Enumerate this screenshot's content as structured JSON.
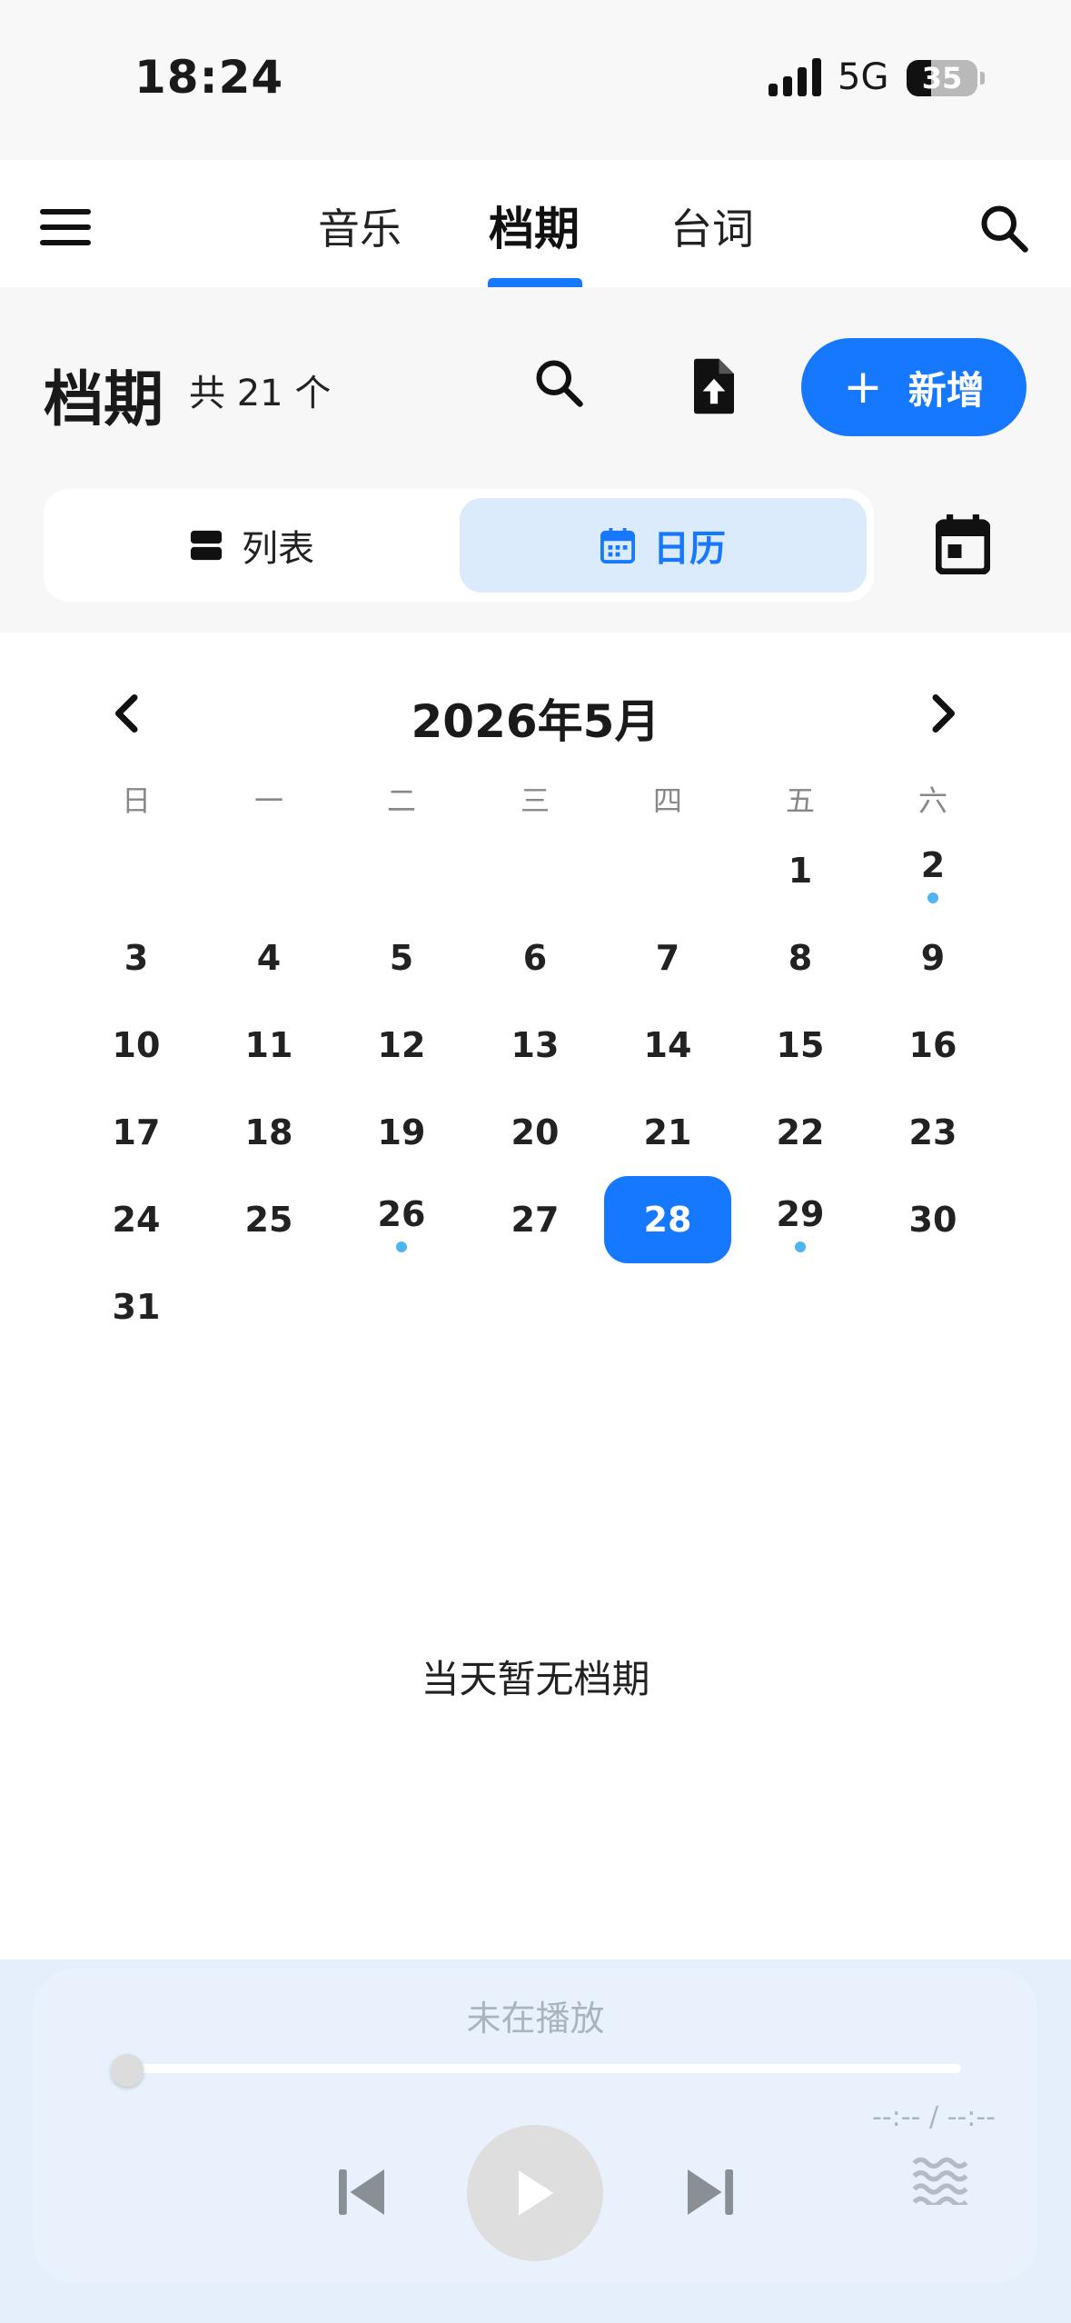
{
  "status_bar": {
    "time": "18:24",
    "network": "5G",
    "battery_text": "35",
    "battery_level": 0.35
  },
  "nav": {
    "tabs": [
      {
        "label": "音乐",
        "active": false
      },
      {
        "label": "档期",
        "active": true
      },
      {
        "label": "台词",
        "active": false
      }
    ]
  },
  "header": {
    "title": "档期",
    "count_text": "共 21 个",
    "add_label": "新增"
  },
  "view_toggle": {
    "list_label": "列表",
    "calendar_label": "日历",
    "selected": "calendar"
  },
  "calendar": {
    "month_title": "2026年5月",
    "weekdays": [
      "日",
      "一",
      "二",
      "三",
      "四",
      "五",
      "六"
    ],
    "days": [
      {
        "n": "1",
        "dot": false
      },
      {
        "n": "2",
        "dot": true
      },
      {
        "n": "3",
        "dot": false
      },
      {
        "n": "4",
        "dot": false
      },
      {
        "n": "5",
        "dot": false
      },
      {
        "n": "6",
        "dot": false
      },
      {
        "n": "7",
        "dot": false
      },
      {
        "n": "8",
        "dot": false
      },
      {
        "n": "9",
        "dot": false
      },
      {
        "n": "10",
        "dot": false
      },
      {
        "n": "11",
        "dot": false
      },
      {
        "n": "12",
        "dot": false
      },
      {
        "n": "13",
        "dot": false
      },
      {
        "n": "14",
        "dot": false
      },
      {
        "n": "15",
        "dot": false
      },
      {
        "n": "16",
        "dot": false
      },
      {
        "n": "17",
        "dot": false
      },
      {
        "n": "18",
        "dot": false
      },
      {
        "n": "19",
        "dot": false
      },
      {
        "n": "20",
        "dot": false
      },
      {
        "n": "21",
        "dot": false
      },
      {
        "n": "22",
        "dot": false
      },
      {
        "n": "23",
        "dot": false
      },
      {
        "n": "24",
        "dot": false
      },
      {
        "n": "25",
        "dot": false
      },
      {
        "n": "26",
        "dot": true
      },
      {
        "n": "27",
        "dot": false
      },
      {
        "n": "28",
        "dot": false
      },
      {
        "n": "29",
        "dot": true
      },
      {
        "n": "30",
        "dot": false
      },
      {
        "n": "31",
        "dot": false
      }
    ],
    "selected_day": "28",
    "empty_message": "当天暂无档期"
  },
  "player": {
    "status": "未在播放",
    "time_text": "--:-- / --:--",
    "progress": 0
  },
  "colors": {
    "accent": "#1677ff",
    "accent_light": "#dcebfc",
    "event_dot": "#4fb5f0",
    "player_bg": "#e4effb"
  },
  "icons": {
    "menu": "hamburger-icon",
    "search": "search-icon",
    "upload": "file-upload-icon",
    "list": "list-icon",
    "calendar": "calendar-icon",
    "today": "calendar-today-icon",
    "prev_month": "chevron-left-icon",
    "next_month": "chevron-right-icon",
    "prev_track": "skip-previous-icon",
    "play": "play-icon",
    "next_track": "skip-next-icon",
    "wave": "waves-icon"
  }
}
